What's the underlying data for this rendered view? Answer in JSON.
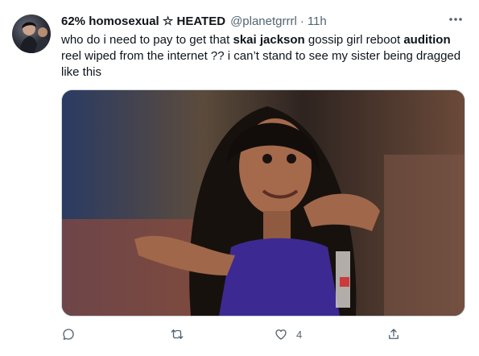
{
  "tweet": {
    "display_name": "62% homosexual ☆ HEATED",
    "handle": "@planetgrrrl",
    "separator": "·",
    "time": "11h",
    "text_parts": [
      "who do i need to pay to get that ",
      "skai jackson",
      " gossip girl reboot ",
      "audition",
      " reel wiped from the internet ?? i can’t stand to see my sister being dragged like this"
    ],
    "likes_count": "4"
  },
  "icons": {
    "more": "more-icon",
    "reply": "reply-icon",
    "retweet": "retweet-icon",
    "like": "like-icon",
    "share": "share-icon"
  },
  "colors": {
    "text": "#0f1419",
    "muted": "#536471",
    "border": "#cfd9de"
  }
}
